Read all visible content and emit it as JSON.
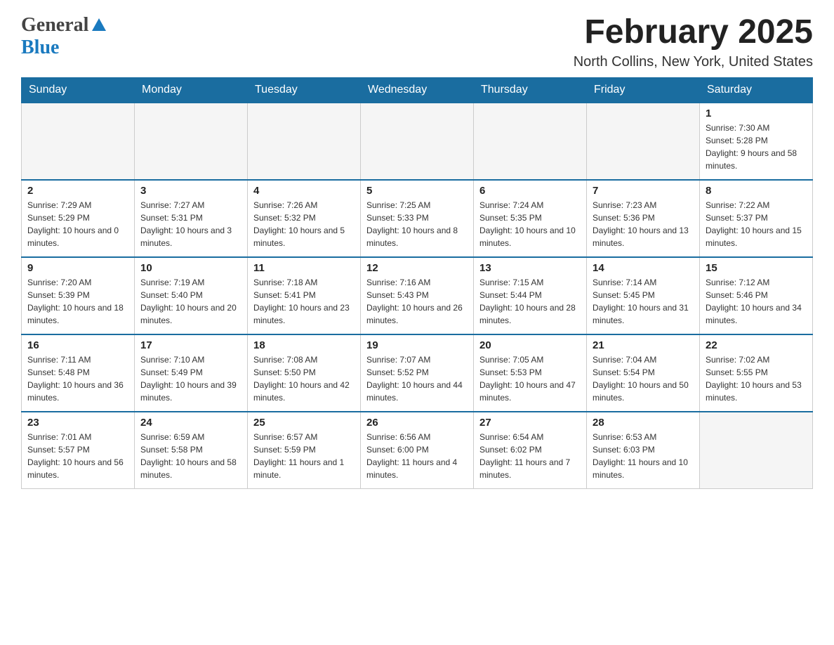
{
  "header": {
    "logo_general": "General",
    "logo_blue": "Blue",
    "month_title": "February 2025",
    "location": "North Collins, New York, United States"
  },
  "days_of_week": [
    "Sunday",
    "Monday",
    "Tuesday",
    "Wednesday",
    "Thursday",
    "Friday",
    "Saturday"
  ],
  "weeks": [
    {
      "cells": [
        {
          "day": "",
          "info": ""
        },
        {
          "day": "",
          "info": ""
        },
        {
          "day": "",
          "info": ""
        },
        {
          "day": "",
          "info": ""
        },
        {
          "day": "",
          "info": ""
        },
        {
          "day": "",
          "info": ""
        },
        {
          "day": "1",
          "info": "Sunrise: 7:30 AM\nSunset: 5:28 PM\nDaylight: 9 hours and 58 minutes."
        }
      ]
    },
    {
      "cells": [
        {
          "day": "2",
          "info": "Sunrise: 7:29 AM\nSunset: 5:29 PM\nDaylight: 10 hours and 0 minutes."
        },
        {
          "day": "3",
          "info": "Sunrise: 7:27 AM\nSunset: 5:31 PM\nDaylight: 10 hours and 3 minutes."
        },
        {
          "day": "4",
          "info": "Sunrise: 7:26 AM\nSunset: 5:32 PM\nDaylight: 10 hours and 5 minutes."
        },
        {
          "day": "5",
          "info": "Sunrise: 7:25 AM\nSunset: 5:33 PM\nDaylight: 10 hours and 8 minutes."
        },
        {
          "day": "6",
          "info": "Sunrise: 7:24 AM\nSunset: 5:35 PM\nDaylight: 10 hours and 10 minutes."
        },
        {
          "day": "7",
          "info": "Sunrise: 7:23 AM\nSunset: 5:36 PM\nDaylight: 10 hours and 13 minutes."
        },
        {
          "day": "8",
          "info": "Sunrise: 7:22 AM\nSunset: 5:37 PM\nDaylight: 10 hours and 15 minutes."
        }
      ]
    },
    {
      "cells": [
        {
          "day": "9",
          "info": "Sunrise: 7:20 AM\nSunset: 5:39 PM\nDaylight: 10 hours and 18 minutes."
        },
        {
          "day": "10",
          "info": "Sunrise: 7:19 AM\nSunset: 5:40 PM\nDaylight: 10 hours and 20 minutes."
        },
        {
          "day": "11",
          "info": "Sunrise: 7:18 AM\nSunset: 5:41 PM\nDaylight: 10 hours and 23 minutes."
        },
        {
          "day": "12",
          "info": "Sunrise: 7:16 AM\nSunset: 5:43 PM\nDaylight: 10 hours and 26 minutes."
        },
        {
          "day": "13",
          "info": "Sunrise: 7:15 AM\nSunset: 5:44 PM\nDaylight: 10 hours and 28 minutes."
        },
        {
          "day": "14",
          "info": "Sunrise: 7:14 AM\nSunset: 5:45 PM\nDaylight: 10 hours and 31 minutes."
        },
        {
          "day": "15",
          "info": "Sunrise: 7:12 AM\nSunset: 5:46 PM\nDaylight: 10 hours and 34 minutes."
        }
      ]
    },
    {
      "cells": [
        {
          "day": "16",
          "info": "Sunrise: 7:11 AM\nSunset: 5:48 PM\nDaylight: 10 hours and 36 minutes."
        },
        {
          "day": "17",
          "info": "Sunrise: 7:10 AM\nSunset: 5:49 PM\nDaylight: 10 hours and 39 minutes."
        },
        {
          "day": "18",
          "info": "Sunrise: 7:08 AM\nSunset: 5:50 PM\nDaylight: 10 hours and 42 minutes."
        },
        {
          "day": "19",
          "info": "Sunrise: 7:07 AM\nSunset: 5:52 PM\nDaylight: 10 hours and 44 minutes."
        },
        {
          "day": "20",
          "info": "Sunrise: 7:05 AM\nSunset: 5:53 PM\nDaylight: 10 hours and 47 minutes."
        },
        {
          "day": "21",
          "info": "Sunrise: 7:04 AM\nSunset: 5:54 PM\nDaylight: 10 hours and 50 minutes."
        },
        {
          "day": "22",
          "info": "Sunrise: 7:02 AM\nSunset: 5:55 PM\nDaylight: 10 hours and 53 minutes."
        }
      ]
    },
    {
      "cells": [
        {
          "day": "23",
          "info": "Sunrise: 7:01 AM\nSunset: 5:57 PM\nDaylight: 10 hours and 56 minutes."
        },
        {
          "day": "24",
          "info": "Sunrise: 6:59 AM\nSunset: 5:58 PM\nDaylight: 10 hours and 58 minutes."
        },
        {
          "day": "25",
          "info": "Sunrise: 6:57 AM\nSunset: 5:59 PM\nDaylight: 11 hours and 1 minute."
        },
        {
          "day": "26",
          "info": "Sunrise: 6:56 AM\nSunset: 6:00 PM\nDaylight: 11 hours and 4 minutes."
        },
        {
          "day": "27",
          "info": "Sunrise: 6:54 AM\nSunset: 6:02 PM\nDaylight: 11 hours and 7 minutes."
        },
        {
          "day": "28",
          "info": "Sunrise: 6:53 AM\nSunset: 6:03 PM\nDaylight: 11 hours and 10 minutes."
        },
        {
          "day": "",
          "info": ""
        }
      ]
    }
  ]
}
